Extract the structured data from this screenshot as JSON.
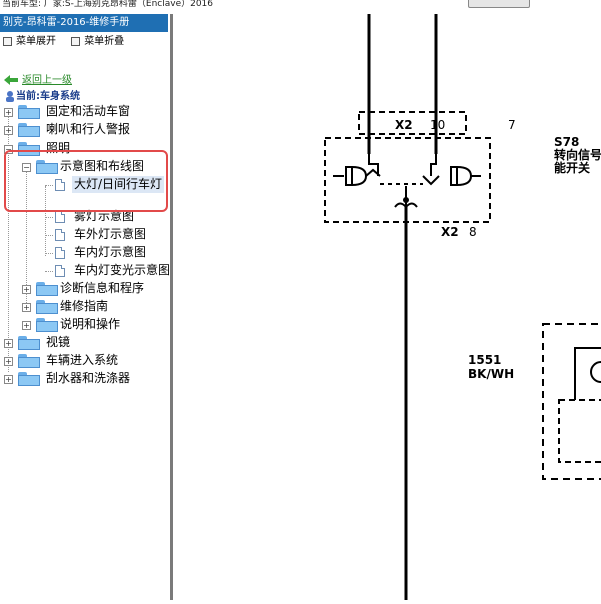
{
  "window": {
    "title": "当前车型: 厂家:S-上海别克昂科雷（Enclave）2016"
  },
  "sidebar": {
    "header": "别克-昂科雷-2016-维修手册",
    "toolbar": {
      "expand_label": "菜单展开",
      "collapse_label": "菜单折叠"
    },
    "back_label": "返回上一级",
    "current_label": "当前:车身系统",
    "tree": [
      {
        "label": "固定和活动车窗"
      },
      {
        "label": "喇叭和行人警报"
      },
      {
        "label": "照明"
      },
      {
        "label": "示意图和布线图"
      },
      {
        "label": "大灯/日间行车灯"
      },
      {
        "label": "雾灯示意图"
      },
      {
        "label": "车外灯示意图"
      },
      {
        "label": "车内灯示意图"
      },
      {
        "label": "车内灯变光示意图"
      },
      {
        "label": "诊断信息和程序"
      },
      {
        "label": "维修指南"
      },
      {
        "label": "说明和操作"
      },
      {
        "label": "视镜"
      },
      {
        "label": "车辆进入系统"
      },
      {
        "label": "刮水器和洗涤器"
      }
    ]
  },
  "diagram": {
    "connector_top": "X2",
    "pin_top": "10",
    "pin_right": "7",
    "connector_bottom": "X2",
    "pin_bottom": "8",
    "component_code": "S78",
    "component_name_line1": "转向信号",
    "component_name_line2": "能开关",
    "wire_circuit": "1551",
    "wire_color": "BK/WH"
  }
}
